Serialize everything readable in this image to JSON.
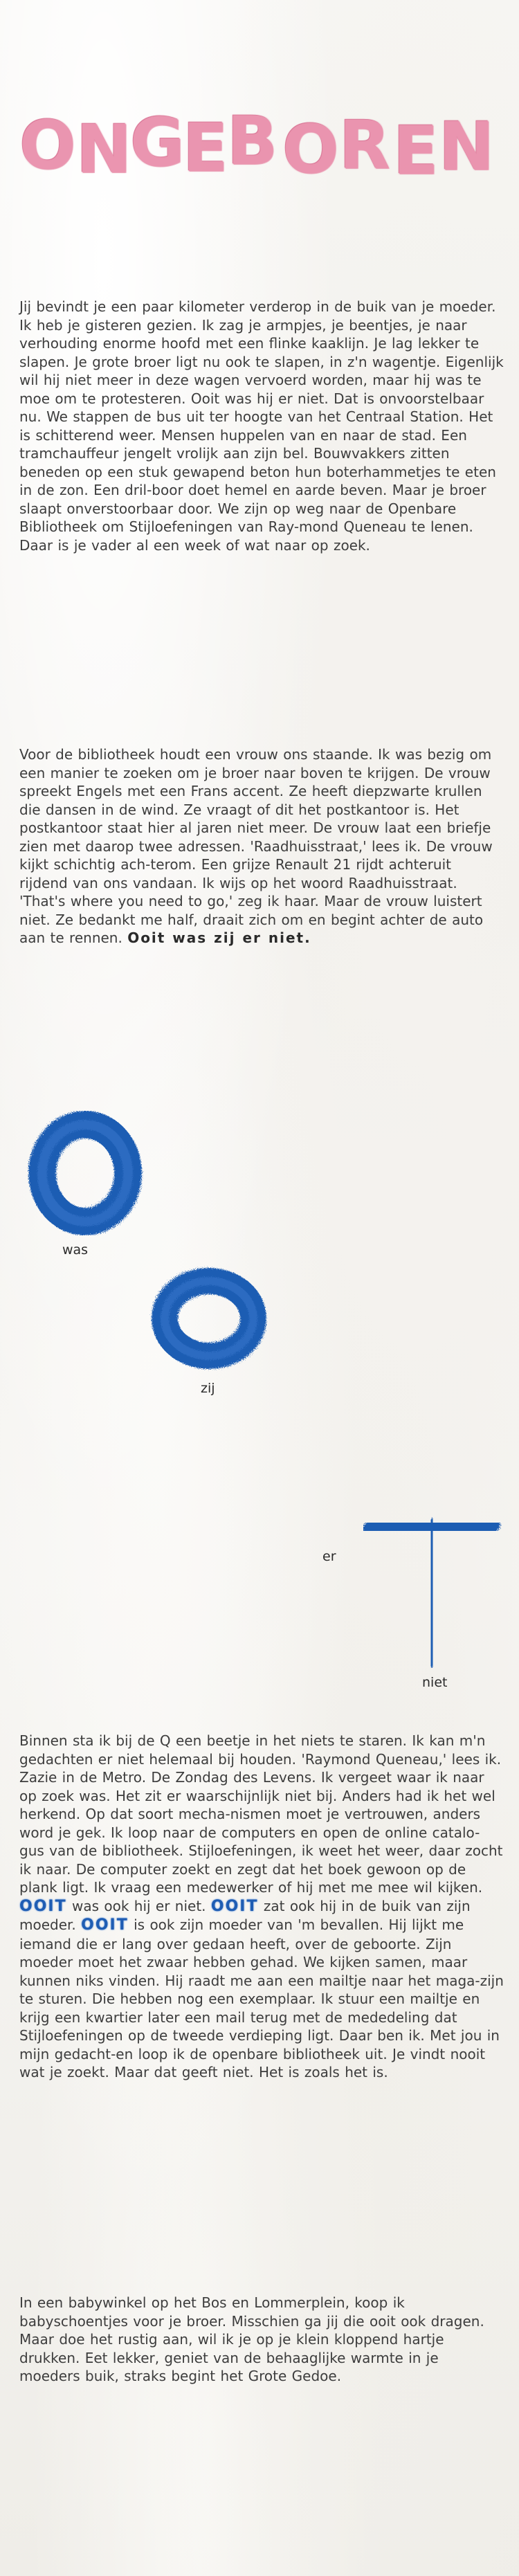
{
  "title": {
    "letters": [
      "O",
      "N",
      "G",
      "E",
      "B",
      "O",
      "R",
      "E",
      "N"
    ]
  },
  "paragraph1": "Jij bevindt je een paar kilometer verderop in de buik van je moeder. Ik heb je gisteren gezien. Ik zag je armpjes, je beentjes, je naar verhouding enorme hoofd met een flinke kaaklijn. Je lag lekker te slapen. Je grote broer ligt nu ook te slapen, in z'n wagentje. Eigenlijk wil hij niet meer in deze wagen vervoerd worden, maar hij was te moe om te protesteren. Ooit was hij er niet. Dat is onvoorstelbaar nu. We stappen de bus uit ter hoogte van het Centraal Station. Het is schitterend weer. Mensen huppelen van en naar de stad. Een tramchauffeur jengelt vrolijk aan zijn bel. Bouwvakkers zitten beneden op een stuk gewapend beton hun boterhammetjes te eten in de zon. Een dril-boor doet hemel en aarde beven. Maar je broer slaapt onverstoorbaar door. We zijn op weg naar de Openbare Bibliotheek om Stijloefeningen van Ray-mond Queneau te lenen. Daar is je vader al een week of wat naar op zoek.",
  "paragraph2": "Voor de bibliotheek houdt een vrouw ons staande. Ik was bezig om een manier te zoeken om je broer naar boven te krijgen. De vrouw spreekt Engels met een Frans accent. Ze heeft diepzwarte krullen die dansen in de wind. Ze vraagt of dit het postkantoor is. Het postkantoor staat hier al jaren niet meer. De vrouw laat een briefje zien met daarop twee adressen. 'Raadhuisstraat,' lees ik. De vrouw kijkt schichtig ach-terom. Een grijze Renault 21 rijdt achteruit rijdend van ons vandaan. Ik wijs op het woord Raadhuisstraat. 'That's where you need to go,' zeg ik haar. Maar de vrouw luistert niet. Ze bedankt me half, draait zich om en begint achter de auto aan te rennen.",
  "paragraph2_end": "Ooit was zij er niet.",
  "ooit_words": [
    "was",
    "zij",
    "er",
    "niet"
  ],
  "paragraph3_parts": [
    "Binnen sta ik bij de Q een beetje in het niets te staren. Ik kan m'n gedachten er niet helemaal bij houden. 'Raymond Queneau,' lees ik. Zazie in de Metro. De Zondag des Levens. Ik vergeet waar ik naar op zoek was. Het zit er waarschijnlijk niet bij. Anders had ik het wel herkend. Op dat soort mecha-nismen moet je vertrouwen, anders word je gek. Ik loop naar de computers en open de online catalo-gus van de bibliotheek. Stijloefeningen, ik weet het weer, daar zocht ik naar. De computer zoekt en zegt dat het boek gewoon op de plank ligt. Ik vraag een medewerker of hij met me mee wil kijken.",
    "was ook hij er niet.",
    "zat ook hij in de buik van zijn moeder.",
    "is ook zijn moeder van 'm bevallen. Hij lijkt me iemand die er lang over gedaan heeft, over de geboorte. Zijn moeder moet het zwaar hebben gehad. We kijken samen, maar kunnen niks vinden. Hij raadt me aan een mailtje naar het maga-zijn te sturen. Die hebben nog een exemplaar. Ik stuur een mailtje en krijg een kwartier later een mail terug met de mededeling dat Stijloefeningen op de tweede verdieping ligt. Daar ben ik. Met jou in mijn gedacht-en loop ik de openbare bibliotheek uit. Je vindt nooit wat je zoekt. Maar dat geeft niet. Het is zoals het is."
  ],
  "ooit_inline": "OOIT",
  "paragraph4": "In een babywinkel op het Bos en Lommerplein, koop ik babyschoentjes voor je broer. Misschien ga jij die ooit ook dragen. Maar doe het rustig aan, wil ik je op je klein kloppend hartje drukken. Eet lekker, geniet van de behaaglijke warmte in je moeders buik, straks begint het Grote Gedoe.",
  "colors": {
    "pink": "#e98aa8",
    "blue": "#1f5db3",
    "text": "#3d3d3d"
  },
  "icons": [
    "fuzzy-o-icon",
    "fuzzy-o-icon",
    "fuzzy-i-icon",
    "fuzzy-t-icon"
  ]
}
